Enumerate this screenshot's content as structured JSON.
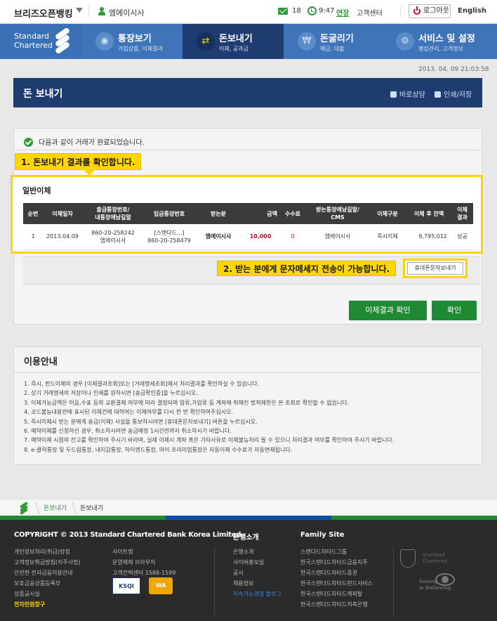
{
  "topbar": {
    "brand": "브리즈오픈뱅킹",
    "username": "엠에이시사",
    "mail_count": "18",
    "time": "9:47",
    "extend": "연장",
    "cs_center": "고객센터",
    "logout": "로그아웃",
    "language": "English"
  },
  "logo": {
    "line1": "Standard",
    "line2": "Chartered"
  },
  "nav": [
    {
      "title": "통장보기",
      "sub": "가입상품, 이체결과",
      "icon": "eye-icon"
    },
    {
      "title": "돈보내기",
      "sub": "이체, 공과금",
      "icon": "transfer-arrows-icon"
    },
    {
      "title": "돈굴리기",
      "sub": "예금, 대출",
      "icon": "coin-icon"
    },
    {
      "title": "서비스 및 설정",
      "sub": "뱅킹관리, 고객정보",
      "icon": "gear-icon"
    }
  ],
  "datetime": "2013. 04. 09 21:03:58",
  "page": {
    "title": "돈 보내기",
    "consult": "바로상담",
    "print": "인쇄/저장"
  },
  "complete_message": "다음과 같이 거래가 완료되었습니다.",
  "callout1": "1. 돈보내기 결과를 확인합니다.",
  "callout2": "2. 받는 분에게 문자메세지 전송이 가능합니다.",
  "result": {
    "title": "일반이체",
    "headers": [
      "순번",
      "이체일자",
      "출금통장번호/\n내통장에남길말",
      "입금통장번호",
      "받는분",
      "금액",
      "수수료",
      "받는통장에남길말/\nCMS",
      "이체구분",
      "이체 후 잔액",
      "이체\n결과"
    ],
    "rows": [
      [
        "1",
        "2013.04.09",
        "860-20-258242\n엠에이시사",
        "[스탠다드...]\n860-20-258479",
        "엠에이시사",
        "10,000",
        "0",
        "엠에이시사",
        "즉시이체",
        "9,795,012",
        "성공"
      ]
    ]
  },
  "sms_button": "휴대폰문자보내기",
  "buttons": {
    "check_result": "이체결과 확인",
    "confirm": "확인"
  },
  "guide": {
    "title": "이용안내",
    "items": [
      "1.  즉시, 펀드이체의 경우 [이체결과조회]또는 [거래명세조회]에서 처리결과를 확인하실 수 있습니다.",
      "2.  상기 거래명세의 저장이나 인쇄를 원하시면 [송금확인증]을 누르십시오.",
      "3.  이체가능금액은 어음,수표 등의 교환결제 여부에 따라 결정되며 압류,가압류 등 계좌에 취해진 법적제한은 본 조회로 확인할 수 없습니다.",
      "4.  코드불능내용란에 표시된 이체건에 대하여는 이체여부를 다시 한 번 확인하여주십시오.",
      "5.  즉시이체시 받는 분에게 송금(이체) 사실을 통보하시려면 [휴대폰문자보내기] 버튼을 누르십시오.",
      "6.  예약이체를 신청하신 경우, 취소하시려면 송금예정 1시간전까지 취소하시기 바랍니다.",
      "7.  예약이체 시점의 잔고를 확인하여 주시기 바라며, 실제 이체시 계좌 혹은 기타사유로 이체불능처리 될 수 있으니 처리결과 여부를 확인하여 주시기 바랍니다.",
      "8.  e-클릭통장 및 두드림통장, 내지갑통장, 하이엔드통장, 마이 프리미엄통장은 자동이체 수수료가 자동면제됩니다."
    ]
  },
  "breadcrumb": {
    "level1": "돈보내기",
    "level2": "돈보내기"
  },
  "footer": {
    "copyright": "COPYRIGHT © 2013 Standard Chartered Bank Korea Limited.",
    "col1": [
      "개인정보처리(취급)방침",
      "고객정보취급방침(지주사법)",
      "안전한 전자금융이용안내",
      "보호금융상품등록부",
      "상품공시실",
      "전자민원창구"
    ],
    "col2": [
      "사이트맵",
      "운영체제 브라우저",
      "고객컨택센터 1588-1599"
    ],
    "bank_head": "은행소개",
    "col3": [
      "은행소개",
      "사이버홍보실",
      "공시",
      "채용정보",
      "지속가능경영 블로그"
    ],
    "family_head": "Family Site",
    "col4": [
      "스탠다드차타드그룹",
      "한국스탠다드차타드금융지주",
      "한국스탠다드차타드증권",
      "한국스탠다드차타드펀드서비스",
      "한국스탠다드차타드캐피탈",
      "한국스탠다드차타드저축은행"
    ],
    "badge_ksqi": "KSQI",
    "badge_wa": "WA",
    "sc_small": "Standard\nChartered",
    "seeing": "Seeing\nis Believing"
  },
  "colors": {
    "nav_blue": "#3f74b9",
    "nav_active": "#1f3c70",
    "green": "#1f8a34",
    "callout_yellow": "#ffd600",
    "amount_red": "#c8102e"
  }
}
